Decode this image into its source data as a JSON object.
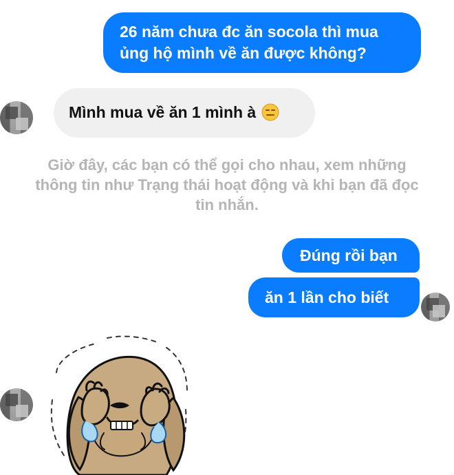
{
  "conversation": {
    "messages": [
      {
        "direction": "outgoing",
        "lines": [
          "26 năm chưa đc ăn socola thì mua",
          "ủng hộ mình về ăn được không?"
        ]
      },
      {
        "direction": "incoming",
        "text": "Mình mua về ăn 1 mình à",
        "emoji": "expressionless-face-icon"
      },
      {
        "direction": "system",
        "lines": [
          "Giờ đây, các bạn có thể gọi cho nhau, xem những",
          "thông tin như Trạng thái hoạt động và khi bạn đã đọc",
          "tin nhắn."
        ]
      },
      {
        "direction": "outgoing",
        "text": "Đúng rồi bạn"
      },
      {
        "direction": "outgoing",
        "text": "ăn 1 lần cho biết"
      },
      {
        "direction": "incoming",
        "sticker": "crying-puppy-sticker"
      }
    ]
  },
  "colors": {
    "outgoing_bubble": "#0a7cff",
    "incoming_bubble": "#f0f0f0",
    "system_text": "#b5b5b5",
    "background": "#ffffff"
  }
}
